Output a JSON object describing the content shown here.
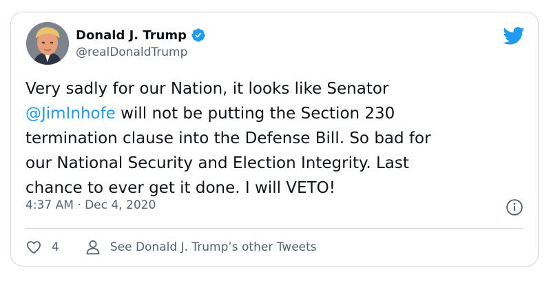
{
  "author": {
    "name": "Donald J. Trump",
    "handle": "@realDonaldTrump",
    "avatar_icon": "profile-photo",
    "verified_icon": "verified-badge-icon"
  },
  "tweet": {
    "lines": [
      {
        "text": "Very sadly for our Nation, it looks like Senator"
      },
      {
        "mention": "@JimInhofe",
        "text": " will not be putting the Section 230"
      },
      {
        "text": "termination clause into the Defense Bill. So bad for"
      },
      {
        "text": "our National Security and Election Integrity. Last"
      },
      {
        "text": "chance to ever get it done. I will VETO!"
      }
    ],
    "timestamp": "4:37 AM · Dec 4, 2020"
  },
  "actions": {
    "like_count": "4",
    "other_tweets_label": "See Donald J. Trump’s other Tweets"
  },
  "icons": {
    "brand": "twitter-bird-icon",
    "info": "info-icon",
    "like": "heart-icon",
    "profile": "person-icon"
  },
  "colors": {
    "text": "#0f1419",
    "secondary": "#536471",
    "accent": "#1d9bf0",
    "border": "#cfd9de"
  }
}
